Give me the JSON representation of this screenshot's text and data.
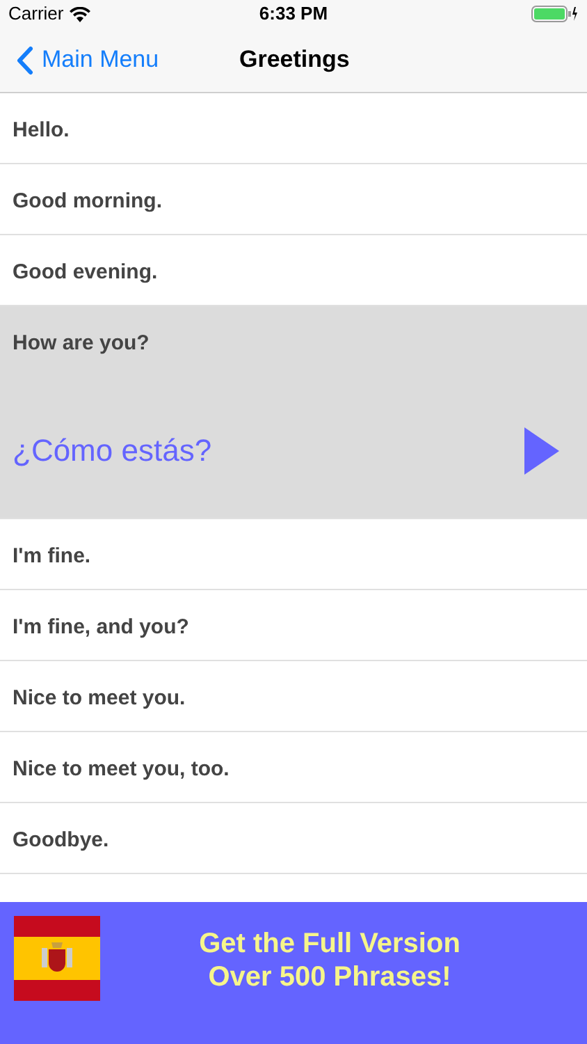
{
  "status_bar": {
    "carrier": "Carrier",
    "time": "6:33 PM"
  },
  "nav": {
    "back": "Main Menu",
    "title": "Greetings"
  },
  "phrases": [
    {
      "text": "Hello.",
      "expanded": false
    },
    {
      "text": "Good morning.",
      "expanded": false
    },
    {
      "text": "Good evening.",
      "expanded": false
    },
    {
      "text": "How are you?",
      "expanded": true,
      "translation": "¿Cómo estás?"
    },
    {
      "text": "I'm fine.",
      "expanded": false
    },
    {
      "text": "I'm fine, and you?",
      "expanded": false
    },
    {
      "text": "Nice to meet you.",
      "expanded": false
    },
    {
      "text": "Nice to meet you, too.",
      "expanded": false
    },
    {
      "text": "Goodbye.",
      "expanded": false
    }
  ],
  "banner": {
    "line_1": "Get the Full Version",
    "line_2": "Over 500 Phrases!"
  }
}
